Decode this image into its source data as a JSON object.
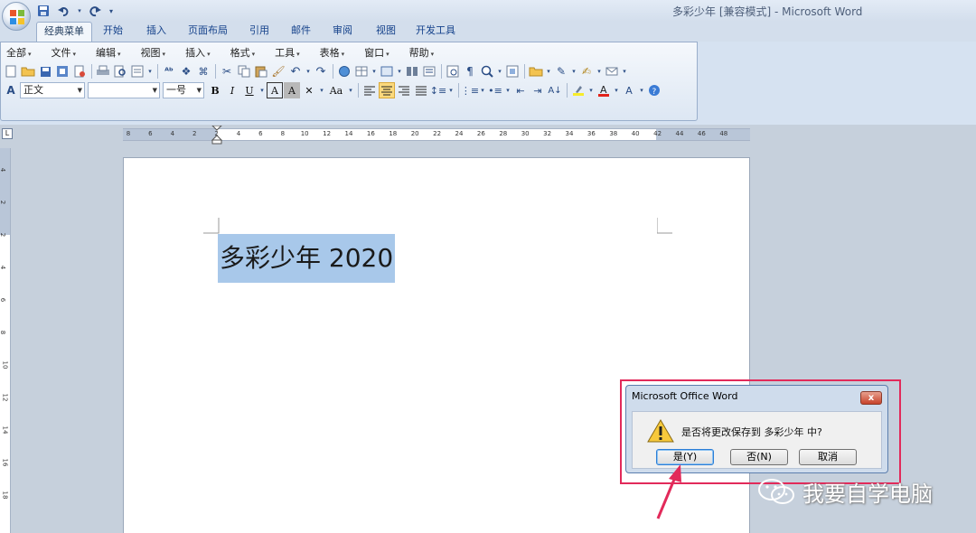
{
  "window": {
    "title": "多彩少年 [兼容模式] - Microsoft Word"
  },
  "quick_access": {
    "save_icon": "save-icon",
    "undo_icon": "undo-icon",
    "redo_icon": "redo-icon"
  },
  "ribbon_tabs": [
    "经典菜单",
    "开始",
    "插入",
    "页面布局",
    "引用",
    "邮件",
    "审阅",
    "视图",
    "开发工具"
  ],
  "classic_menu": {
    "items": [
      "全部",
      "文件",
      "编辑",
      "视图",
      "插入",
      "格式",
      "工具",
      "表格",
      "窗口",
      "帮助"
    ]
  },
  "format_bar": {
    "style_value": "正文",
    "font_value": "",
    "size_value": "一号",
    "bold": "B",
    "italic": "I",
    "underline": "U",
    "change_case": "Aa"
  },
  "ruler": {
    "labels": [
      "8",
      "6",
      "4",
      "2",
      "2",
      "4",
      "6",
      "8",
      "10",
      "12",
      "14",
      "16",
      "18",
      "20",
      "22",
      "24",
      "26",
      "28",
      "30",
      "32",
      "34",
      "36",
      "38",
      "40",
      "42",
      "44",
      "46",
      "48"
    ],
    "vertical_labels": [
      "4",
      "2",
      "2",
      "4",
      "6",
      "8",
      "10",
      "12",
      "14",
      "16",
      "18"
    ]
  },
  "document": {
    "text": "多彩少年 2020"
  },
  "dialog": {
    "title": "Microsoft Office Word",
    "message": "是否将更改保存到 多彩少年 中?",
    "yes_label": "是(Y)",
    "no_label": "否(N)",
    "cancel_label": "取消",
    "close_label": "x"
  },
  "watermark": {
    "text": "我要自学电脑"
  },
  "colors": {
    "selection": "#a8c8ea",
    "highlight_border": "#e22a5a",
    "arrow": "#e22a5a"
  }
}
